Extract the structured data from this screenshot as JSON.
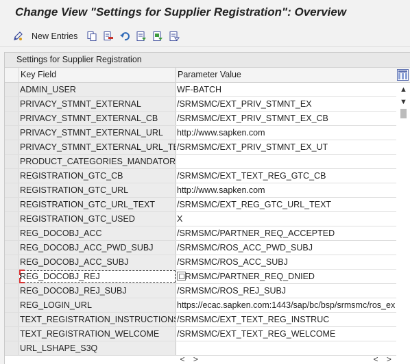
{
  "window": {
    "title": "Change View \"Settings for Supplier Registration\": Overview"
  },
  "toolbar": {
    "new_entries_label": "New Entries",
    "icons": [
      "edit-pen-icon",
      "copy-icon",
      "delete-icon",
      "undo-icon",
      "select-all-icon",
      "select-block-icon",
      "deselect-all-icon"
    ]
  },
  "table": {
    "caption": "Settings for Supplier Registration",
    "columns": [
      "Key Field",
      "Parameter Value"
    ],
    "rows": [
      {
        "key": "ADMIN_USER",
        "value": "WF-BATCH"
      },
      {
        "key": "PRIVACY_STMNT_EXTERNAL",
        "value": "/SRMSMC/EXT_PRIV_STMNT_EX"
      },
      {
        "key": "PRIVACY_STMNT_EXTERNAL_CB",
        "value": "/SRMSMC/EXT_PRIV_STMNT_EX_CB"
      },
      {
        "key": "PRIVACY_STMNT_EXTERNAL_URL",
        "value": "http://www.sapken.com"
      },
      {
        "key": "PRIVACY_STMNT_EXTERNAL_URL_TEXT",
        "value": "/SRMSMC/EXT_PRIV_STMNT_EX_UT"
      },
      {
        "key": "PRODUCT_CATEGORIES_MANDATORY",
        "value": ""
      },
      {
        "key": "REGISTRATION_GTC_CB",
        "value": "/SRMSMC/EXT_TEXT_REG_GTC_CB"
      },
      {
        "key": "REGISTRATION_GTC_URL",
        "value": "http://www.sapken.com"
      },
      {
        "key": "REGISTRATION_GTC_URL_TEXT",
        "value": "/SRMSMC/EXT_REG_GTC_URL_TEXT"
      },
      {
        "key": "REGISTRATION_GTC_USED",
        "value": "X"
      },
      {
        "key": "REG_DOCOBJ_ACC",
        "value": "/SRMSMC/PARTNER_REQ_ACCEPTED"
      },
      {
        "key": "REG_DOCOBJ_ACC_PWD_SUBJ",
        "value": "/SRMSMC/ROS_ACC_PWD_SUBJ"
      },
      {
        "key": "REG_DOCOBJ_ACC_SUBJ",
        "value": "/SRMSMC/ROS_ACC_SUBJ"
      },
      {
        "key": "REG_DOCOBJ_REJ",
        "value": "/SRMSMC/PARTNER_REQ_DNIED"
      },
      {
        "key": "REG_DOCOBJ_REJ_SUBJ",
        "value": "/SRMSMC/ROS_REJ_SUBJ"
      },
      {
        "key": "REG_LOGIN_URL",
        "value": "https://ecac.sapken.com:1443/sap/bc/bsp/srmsmc/ros_ex"
      },
      {
        "key": "TEXT_REGISTRATION_INSTRUCTIONS",
        "value": "/SRMSMC/EXT_TEXT_REG_INSTRUC"
      },
      {
        "key": "TEXT_REGISTRATION_WELCOME",
        "value": "/SRMSMC/EXT_TEXT_REG_WELCOME"
      },
      {
        "key": "URL_LSHAPE_S3Q",
        "value": ""
      }
    ],
    "focused_row_index": 13
  },
  "scroll": {
    "up": "▲",
    "down": "▼",
    "left": "<",
    "right": ">"
  }
}
